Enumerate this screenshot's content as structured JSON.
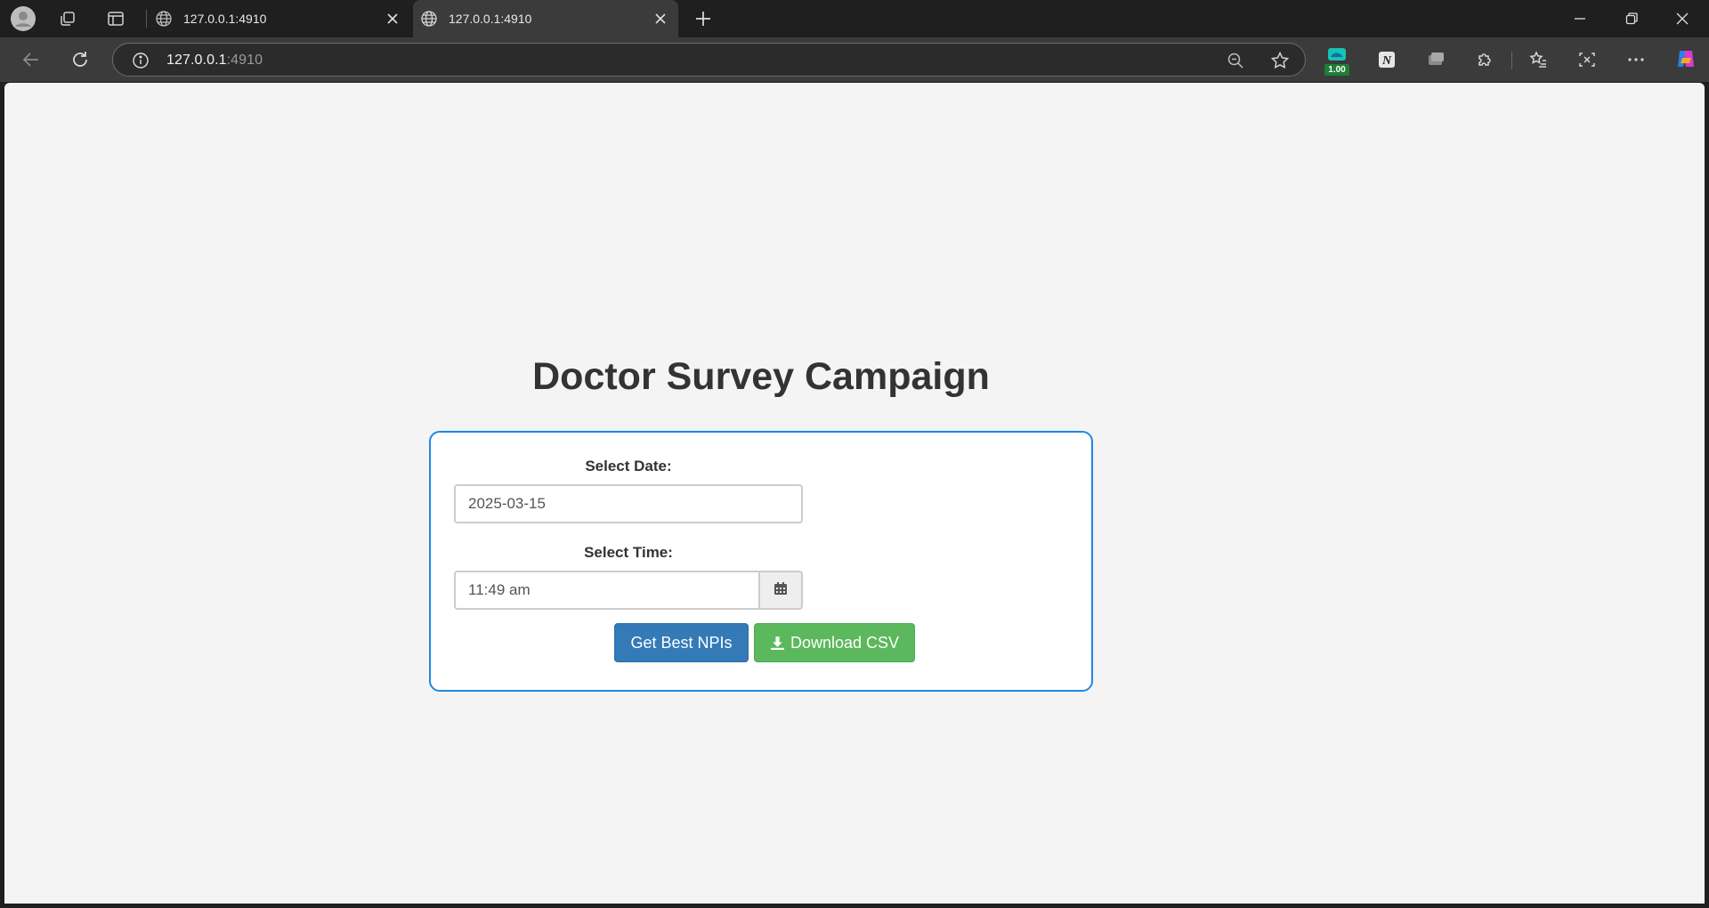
{
  "browser": {
    "tabs": [
      {
        "title": "127.0.0.1:4910",
        "active": false
      },
      {
        "title": "127.0.0.1:4910",
        "active": true
      }
    ],
    "address": {
      "host": "127.0.0.1",
      "port": ":4910"
    },
    "extension_badge": "1.00"
  },
  "page": {
    "title": "Doctor Survey Campaign",
    "date_label": "Select Date:",
    "date_value": "2025-03-15",
    "time_label": "Select Time:",
    "time_value": "11:49 am",
    "get_npis_label": "Get Best NPIs",
    "download_label": "Download CSV"
  },
  "colors": {
    "card_border": "#1e88e5",
    "primary_button": "#337ab7",
    "success_button": "#5cb85c",
    "page_background": "#f4f4f4"
  }
}
